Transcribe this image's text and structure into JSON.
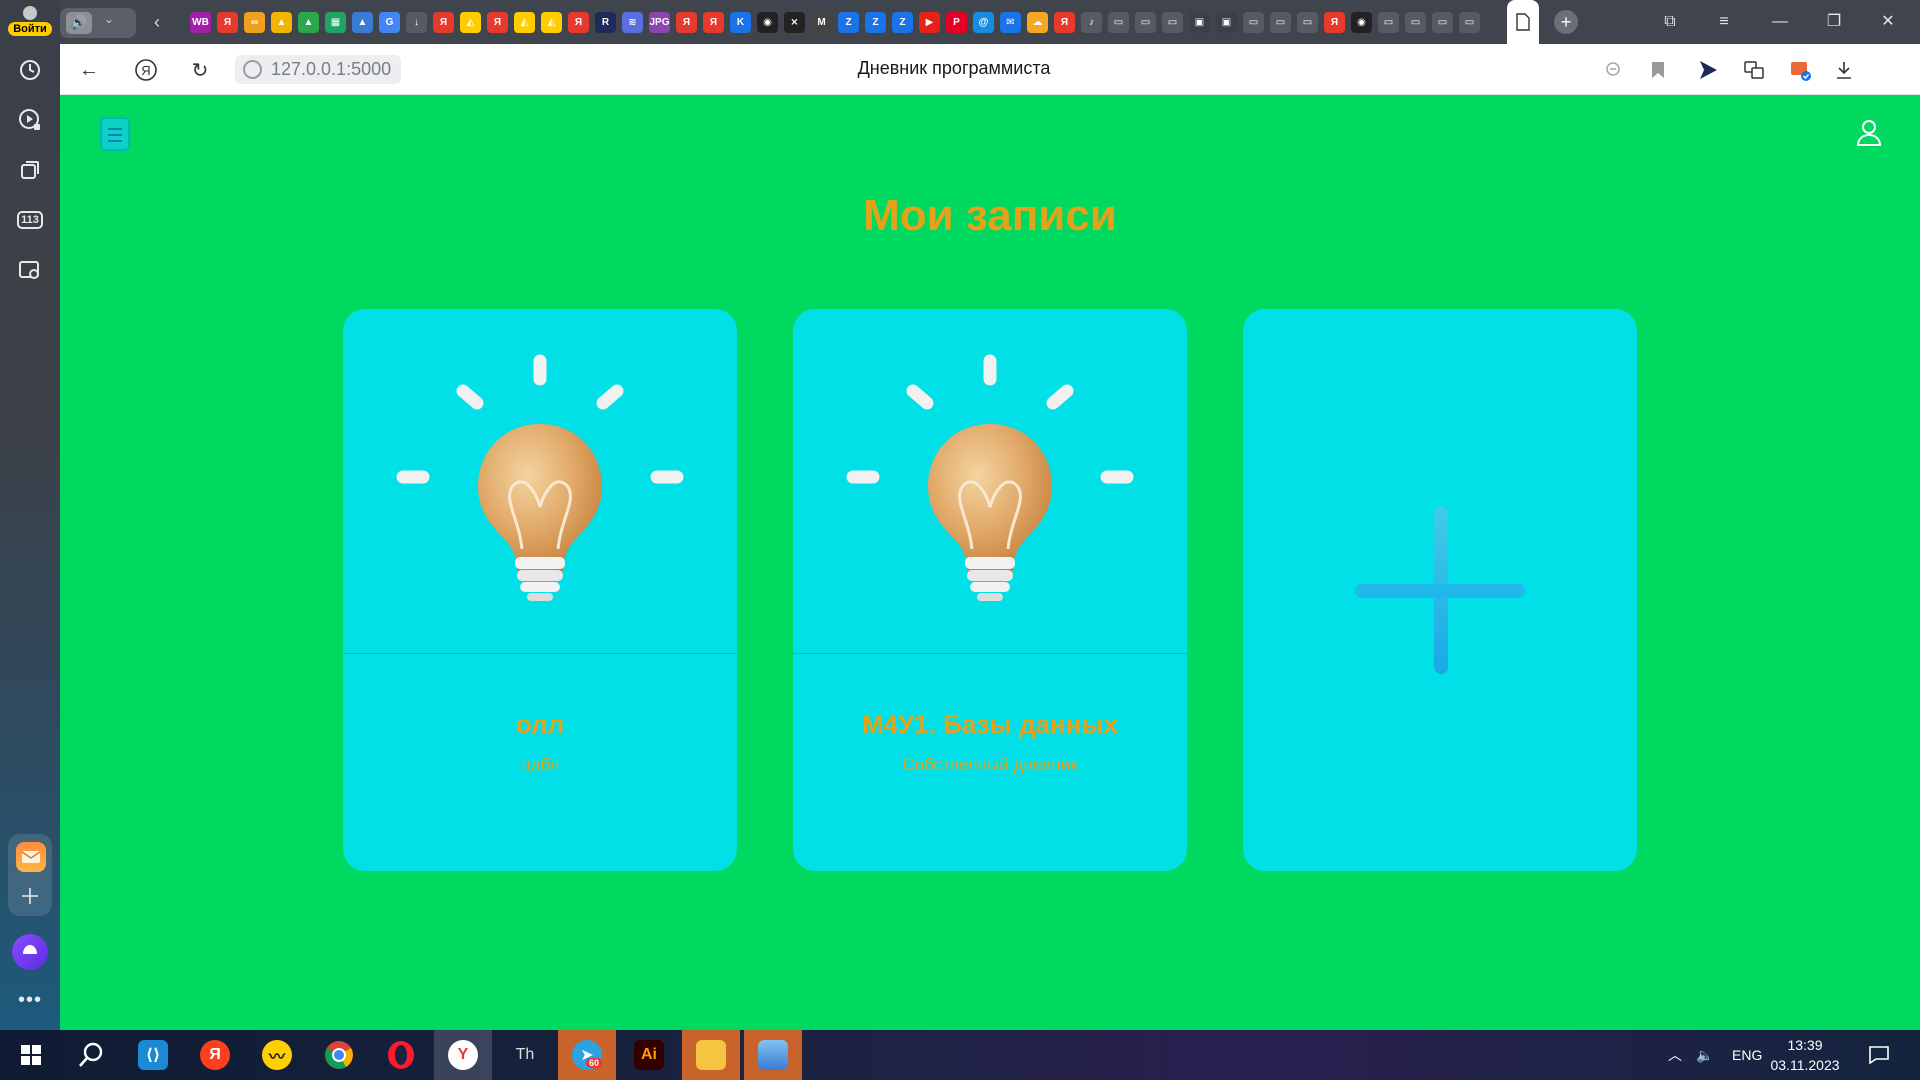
{
  "sidebar": {
    "login_label": "Войти",
    "badge_count": "113",
    "icons": [
      "history-icon",
      "video-icon",
      "collections-icon",
      "badge-113-icon",
      "screenshot-icon",
      "mail-icon",
      "add-icon",
      "alice-icon",
      "more-icon"
    ]
  },
  "tabs": {
    "favicons": [
      {
        "label": "WB",
        "color": "#a020a8"
      },
      {
        "label": "Я",
        "color": "#e83a2c"
      },
      {
        "label": "∞",
        "color": "#f0a020"
      },
      {
        "label": "▲",
        "color": "#f2b400"
      },
      {
        "label": "▲",
        "color": "#2aa84a"
      },
      {
        "label": "▦",
        "color": "#21a463"
      },
      {
        "label": "▲",
        "color": "#3a7bd5"
      },
      {
        "label": "G",
        "color": "#4285f4"
      },
      {
        "label": "↓",
        "color": "#555a63"
      },
      {
        "label": "Я",
        "color": "#e83a2c"
      },
      {
        "label": "◭",
        "color": "#ffcc00"
      },
      {
        "label": "Я",
        "color": "#e83a2c"
      },
      {
        "label": "◭",
        "color": "#ffcc00"
      },
      {
        "label": "◭",
        "color": "#ffcc00"
      },
      {
        "label": "Я",
        "color": "#e83a2c"
      },
      {
        "label": "R",
        "color": "#1e2a5a"
      },
      {
        "label": "≋",
        "color": "#5b6ee0"
      },
      {
        "label": "JPG",
        "color": "#8e44ad"
      },
      {
        "label": "Я",
        "color": "#e83a2c"
      },
      {
        "label": "Я",
        "color": "#e83a2c"
      },
      {
        "label": "K",
        "color": "#1a73e8"
      },
      {
        "label": "◉",
        "color": "#222222"
      },
      {
        "label": "⨯",
        "color": "#222222"
      },
      {
        "label": "M",
        "color": "#444444"
      },
      {
        "label": "Z",
        "color": "#1a73e8"
      },
      {
        "label": "Z",
        "color": "#1a73e8"
      },
      {
        "label": "Z",
        "color": "#1a73e8"
      },
      {
        "label": "▶",
        "color": "#e62117"
      },
      {
        "label": "P",
        "color": "#e60023"
      },
      {
        "label": "@",
        "color": "#168de2"
      },
      {
        "label": "✉",
        "color": "#1a73e8"
      },
      {
        "label": "☁",
        "color": "#f5a623"
      },
      {
        "label": "Я",
        "color": "#e83a2c"
      },
      {
        "label": "♪",
        "color": "#555a63"
      },
      {
        "label": "▭",
        "color": "#555a63"
      },
      {
        "label": "▭",
        "color": "#555a63"
      },
      {
        "label": "▭",
        "color": "#555a63"
      },
      {
        "label": "▣",
        "color": "#3a3f48"
      },
      {
        "label": "▣",
        "color": "#3a3f48"
      },
      {
        "label": "▭",
        "color": "#555a63"
      },
      {
        "label": "▭",
        "color": "#555a63"
      },
      {
        "label": "▭",
        "color": "#555a63"
      },
      {
        "label": "Я",
        "color": "#e83a2c"
      },
      {
        "label": "◉",
        "color": "#222222"
      },
      {
        "label": "▭",
        "color": "#555a63"
      },
      {
        "label": "▭",
        "color": "#555a63"
      },
      {
        "label": "▭",
        "color": "#555a63"
      },
      {
        "label": "▭",
        "color": "#555a63"
      }
    ],
    "new_tab_label": "+"
  },
  "addressbar": {
    "url": "127.0.0.1:5000",
    "page_title": "Дневник программиста"
  },
  "page": {
    "heading": "Мои записи",
    "accent_color": "#e3a21a",
    "background_color": "#00d960",
    "card_color": "#00e0e6",
    "cards": [
      {
        "title": "олл",
        "subtitle": "лдбл",
        "image": "lightbulb-icon"
      },
      {
        "title": "М4У1. Базы данных",
        "subtitle": "Собственный дневник",
        "image": "lightbulb-icon"
      }
    ],
    "add_card_icon": "plus-icon"
  },
  "taskbar": {
    "apps": [
      "windows-start-icon",
      "search-icon",
      "vscode-icon",
      "yandex-icon",
      "yandex-market-icon",
      "chrome-icon",
      "opera-icon",
      "yandex-browser-icon",
      "typora-icon",
      "telegram-icon",
      "illustrator-icon",
      "file-explorer-icon",
      "photos-icon"
    ],
    "telegram_badge": "60",
    "language": "ENG",
    "time": "13:39",
    "date": "03.11.2023"
  }
}
